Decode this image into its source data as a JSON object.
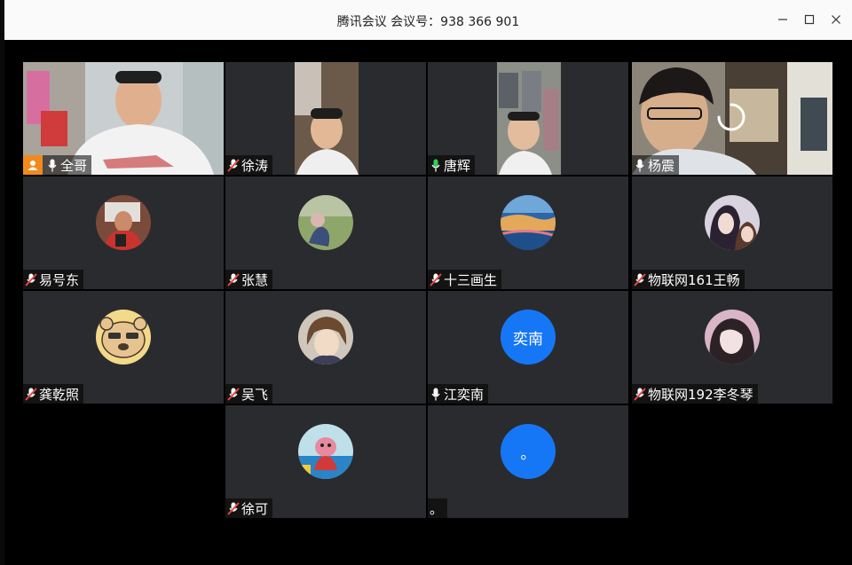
{
  "window": {
    "title": "腾讯会议 会议号：938 366 901"
  },
  "participants": [
    {
      "name": "全哥",
      "mic": "on",
      "host": true
    },
    {
      "name": "徐涛",
      "mic": "muted"
    },
    {
      "name": "唐辉",
      "mic": "speaking"
    },
    {
      "name": "杨震",
      "mic": "on"
    },
    {
      "name": "易号东",
      "mic": "muted"
    },
    {
      "name": "张慧",
      "mic": "muted"
    },
    {
      "name": "十三画生",
      "mic": "muted"
    },
    {
      "name": "物联网161王畅",
      "mic": "muted"
    },
    {
      "name": "龚乾照",
      "mic": "muted"
    },
    {
      "name": "吴飞",
      "mic": "muted"
    },
    {
      "name": "江奕南",
      "mic": "on",
      "avatar_text": "奕南"
    },
    {
      "name": "物联网192李冬琴",
      "mic": "muted"
    },
    {
      "name": "徐可",
      "mic": "muted"
    },
    {
      "name": "。",
      "mic": "none",
      "avatar_text": "。"
    }
  ],
  "colors": {
    "tile_bg": "#2a2b2e",
    "host_badge": "#f08a1c",
    "avatar_blue": "#1677f6",
    "mic_speaking": "#2fd157",
    "mic_muted": "#e6473f"
  }
}
